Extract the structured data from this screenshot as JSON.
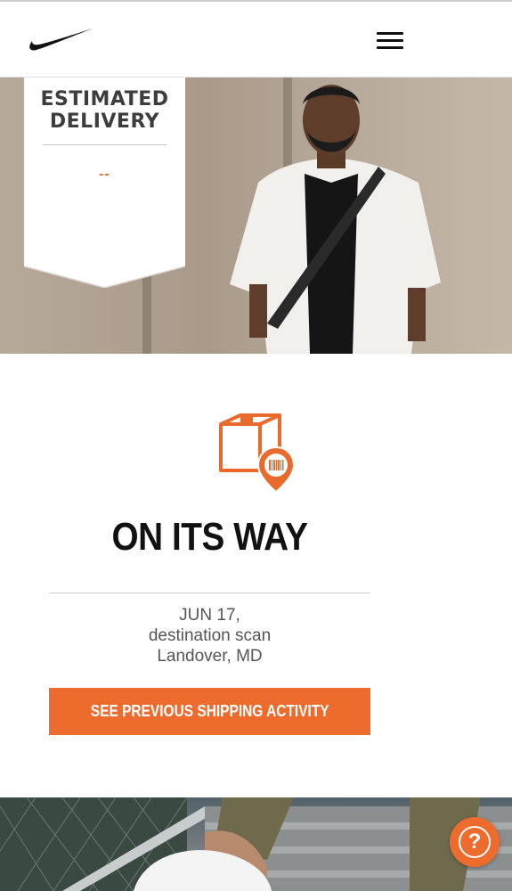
{
  "header": {
    "logo_icon": "swoosh-logo-icon",
    "menu_icon": "hamburger-menu-icon"
  },
  "hero": {
    "banner_title": "ESTIMATED DELIVERY",
    "banner_date": "--"
  },
  "status": {
    "icon": "package-location-icon",
    "title": "ON ITS WAY",
    "date": "JUN 17,",
    "event": "destination scan",
    "location": "Landover, MD",
    "button_label": "SEE PREVIOUS SHIPPING ACTIVITY"
  },
  "help": {
    "icon": "help-question-icon",
    "label": "?"
  },
  "colors": {
    "accent": "#ec6b2d",
    "text_dark": "#111111",
    "text_muted": "#555555"
  }
}
